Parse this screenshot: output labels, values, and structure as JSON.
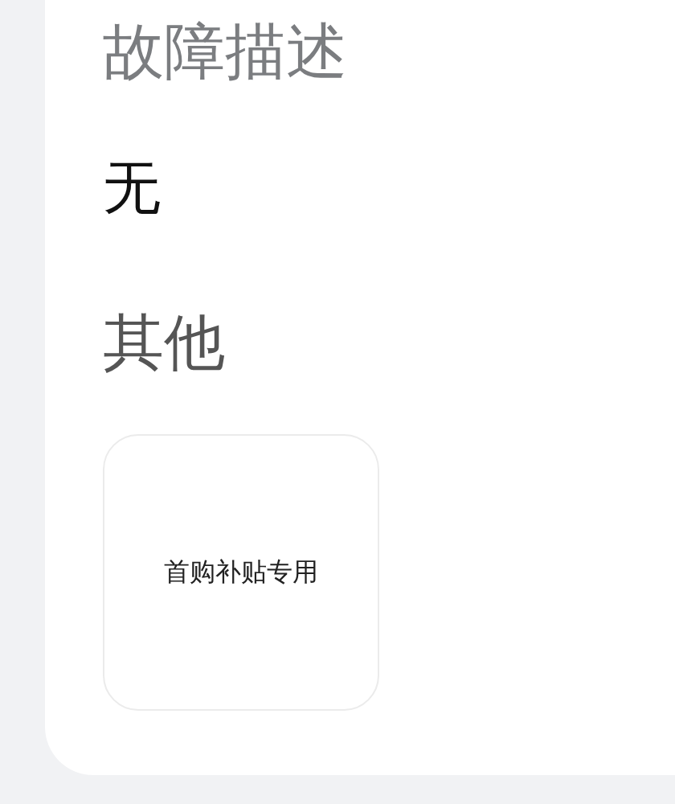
{
  "sections": [
    {
      "heading": "故障描述",
      "value": "无"
    },
    {
      "heading": "其他",
      "tiles": [
        {
          "label": "首购补贴专用"
        }
      ]
    }
  ]
}
